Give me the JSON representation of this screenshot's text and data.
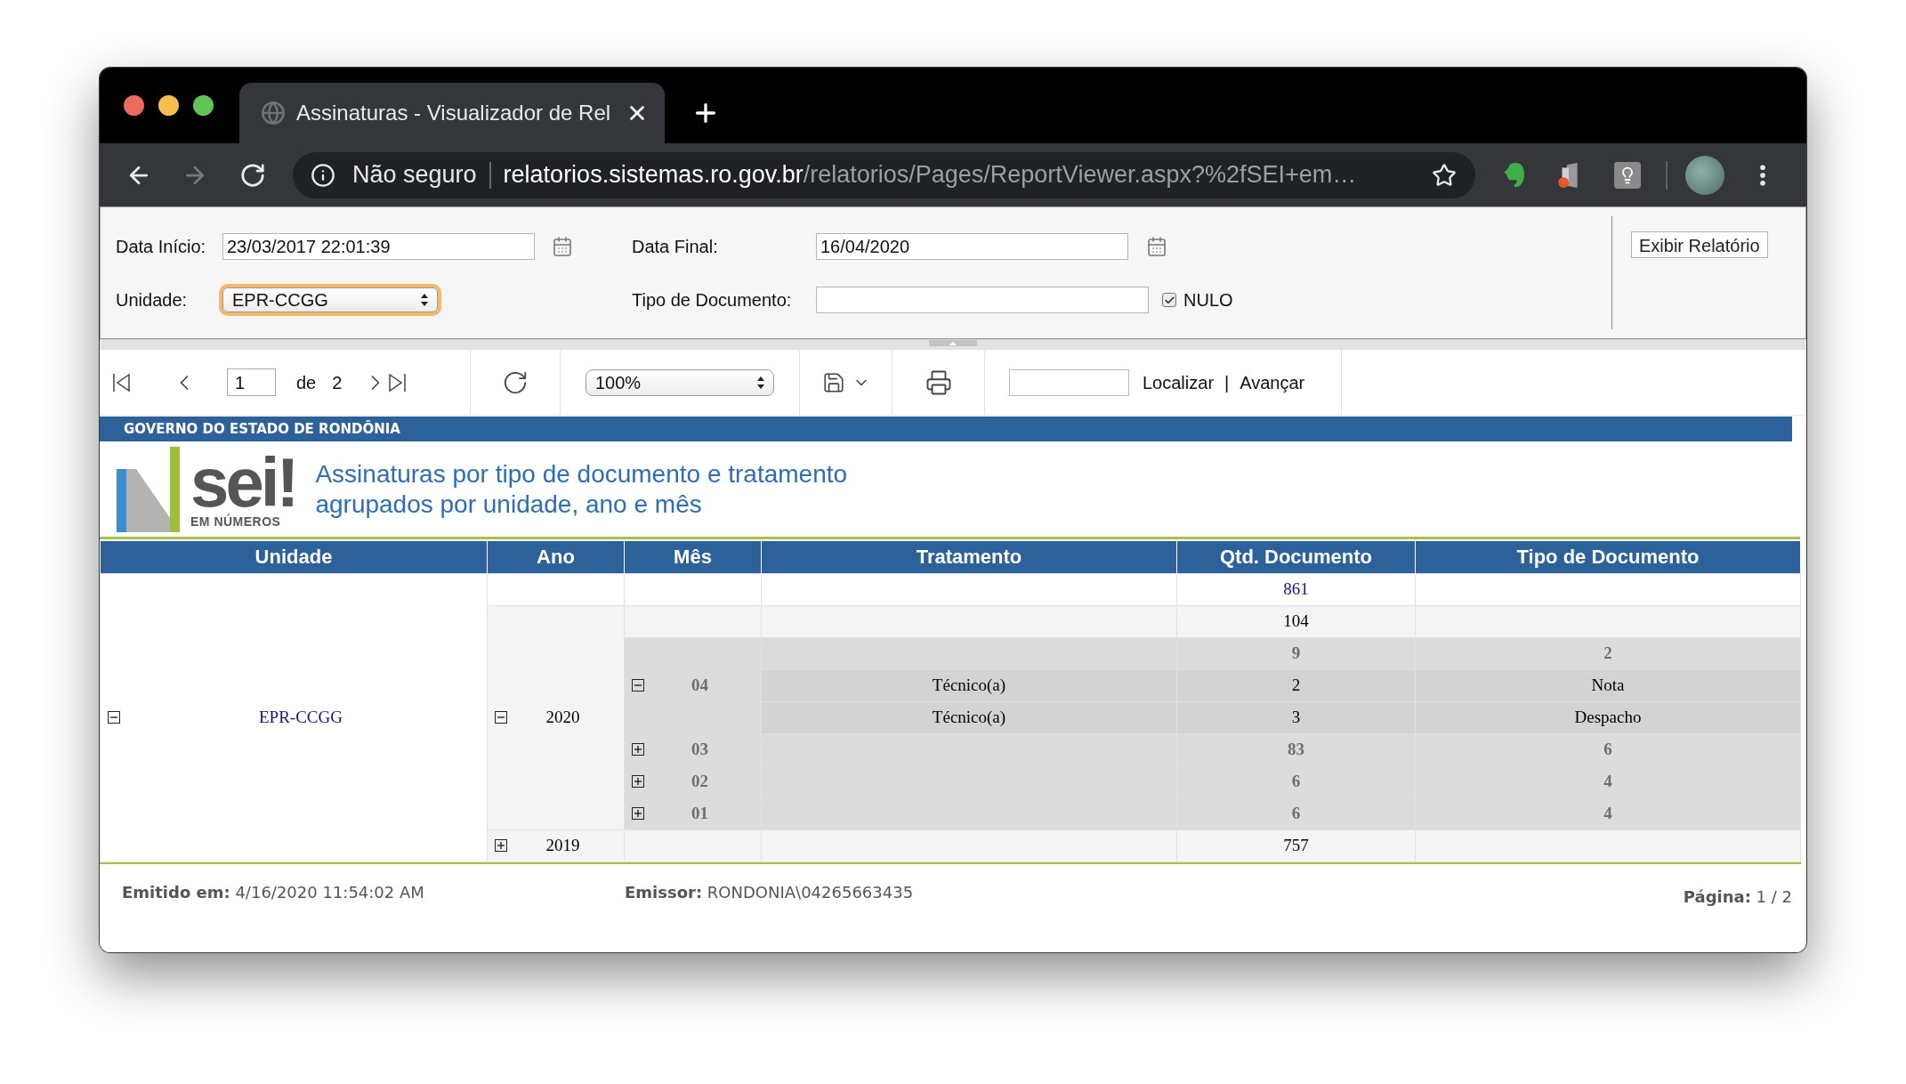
{
  "browser": {
    "tab": {
      "title": "Assinaturas - Visualizador de Rel"
    },
    "address": {
      "security": "Não seguro",
      "host": "relatorios.sistemas.ro.gov.br",
      "path": "/relatorios/Pages/ReportViewer.aspx?%2fSEI+em…"
    }
  },
  "parameters": {
    "data_inicio": {
      "label": "Data Início:",
      "value": "23/03/2017 22:01:39"
    },
    "data_final": {
      "label": "Data Final:",
      "value": "16/04/2020"
    },
    "unidade": {
      "label": "Unidade:",
      "value": "EPR-CCGG",
      "focused": true
    },
    "tipo_documento": {
      "label": "Tipo de Documento:"
    },
    "nulo": {
      "label": "NULO",
      "checked": true
    },
    "submit": "Exibir Relatório"
  },
  "toolbar": {
    "page": "1",
    "of_label": "de",
    "page_count": "2",
    "zoom": "100%",
    "find": {
      "label": "Localizar",
      "separator": "|",
      "next": "Avançar"
    }
  },
  "report": {
    "banner": "GOVERNO DO ESTADO DE RONDÔNIA",
    "logo": {
      "wordmark": "sei!",
      "tagline": "EM NÚMEROS"
    },
    "title_lines": [
      "Assinaturas por tipo de documento e tratamento",
      "agrupados por unidade, ano e mês"
    ],
    "table": {
      "columns": [
        "Unidade",
        "Ano",
        "Mês",
        "Tratamento",
        "Qtd. Documento",
        "Tipo de Documento"
      ],
      "groups": [
        {
          "unidade": "EPR-CCGG",
          "expanded": true,
          "qtd": "861",
          "children": [
            {
              "ano": "2020",
              "expanded": true,
              "qtd": "104",
              "children": [
                {
                  "mes": "04",
                  "expanded": true,
                  "qtd": "9",
                  "tipo": "2",
                  "children": [
                    {
                      "tratamento": "Técnico(a)",
                      "qtd": "2",
                      "tipo": "Nota"
                    },
                    {
                      "tratamento": "Técnico(a)",
                      "qtd": "3",
                      "tipo": "Despacho"
                    }
                  ]
                },
                {
                  "mes": "03",
                  "expanded": false,
                  "qtd": "83",
                  "tipo": "6"
                },
                {
                  "mes": "02",
                  "expanded": false,
                  "qtd": "6",
                  "tipo": "4"
                },
                {
                  "mes": "01",
                  "expanded": false,
                  "qtd": "6",
                  "tipo": "4"
                }
              ]
            },
            {
              "ano": "2019",
              "expanded": false,
              "qtd": "757"
            }
          ]
        }
      ]
    },
    "footer": {
      "issued": "**Emitido em:** 4/16/2020 11:54:02 AM",
      "issuer": "**Emissor:** RONDONIA\\04265663435",
      "page": "**Página:** 1 / 2"
    }
  }
}
